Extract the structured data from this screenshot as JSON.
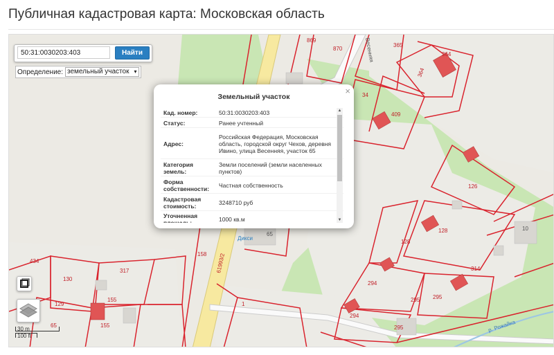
{
  "page": {
    "title": "Публичная кадастровая карта: Московская область"
  },
  "search": {
    "value": "50:31:0030203:403",
    "button_label": "Найти"
  },
  "definition": {
    "label": "Определение:",
    "selected": "земельный участок"
  },
  "popup": {
    "title": "Земельный участок",
    "close_glyph": "×",
    "rows": [
      {
        "key": "Кад. номер:",
        "value": "50:31:0030203:403"
      },
      {
        "key": "Статус:",
        "value": "Ранее учтенный"
      },
      {
        "key": "Адрес:",
        "value": "Российская Федерация, Московская область, городской округ Чехов, деревня Ивино, улица Весенняя, участок 65"
      },
      {
        "key": "Категория земель:",
        "value": "Земли поселений (земли населенных пунктов)"
      },
      {
        "key": "Форма собственности:",
        "value": "Частная собственность"
      },
      {
        "key": "Кадастровая стоимость:",
        "value": "3248710 руб"
      },
      {
        "key": "Уточненная площадь:",
        "value": "1000 кв.м"
      }
    ]
  },
  "map": {
    "labels": [
      {
        "id": "l869",
        "text": "869"
      },
      {
        "id": "l870",
        "text": "870"
      },
      {
        "id": "l365",
        "text": "365"
      },
      {
        "id": "l364a",
        "text": "364"
      },
      {
        "id": "l364b",
        "text": "364"
      },
      {
        "id": "l34",
        "text": "34"
      },
      {
        "id": "l409",
        "text": "409"
      },
      {
        "id": "l126",
        "text": "126"
      },
      {
        "id": "l128a",
        "text": "128"
      },
      {
        "id": "l128b",
        "text": "128"
      },
      {
        "id": "l10",
        "text": "10"
      },
      {
        "id": "l65",
        "text": "65"
      },
      {
        "id": "l158",
        "text": "158"
      },
      {
        "id": "l61993",
        "text": "61993/2"
      },
      {
        "id": "l314",
        "text": "314"
      },
      {
        "id": "l294a",
        "text": "294"
      },
      {
        "id": "l294b",
        "text": "294"
      },
      {
        "id": "l295a",
        "text": "295"
      },
      {
        "id": "l295b",
        "text": "295"
      },
      {
        "id": "l295c",
        "text": "295"
      },
      {
        "id": "l434",
        "text": "434"
      },
      {
        "id": "l130",
        "text": "130"
      },
      {
        "id": "l317",
        "text": "317"
      },
      {
        "id": "l129",
        "text": "129"
      },
      {
        "id": "l155a",
        "text": "155"
      },
      {
        "id": "l155b",
        "text": "155"
      },
      {
        "id": "l65b",
        "text": "65"
      },
      {
        "id": "l1",
        "text": "1"
      },
      {
        "id": "lriver",
        "text": "р. Рожайка"
      },
      {
        "id": "lsz",
        "text": "Весенняя"
      },
      {
        "id": "ldiksi",
        "text": "Дикси"
      }
    ],
    "scale_metric": "30 m",
    "scale_imperial": "100 ft"
  },
  "colors": {
    "parcel_stroke": "#d9232d",
    "building": "#e05555",
    "green": "#c9e6b4",
    "road": "#f7e9a0",
    "accent": "#2a7fc1"
  },
  "icons": {
    "layers": "layers-icon",
    "frame": "frame-icon",
    "close": "close-icon"
  }
}
